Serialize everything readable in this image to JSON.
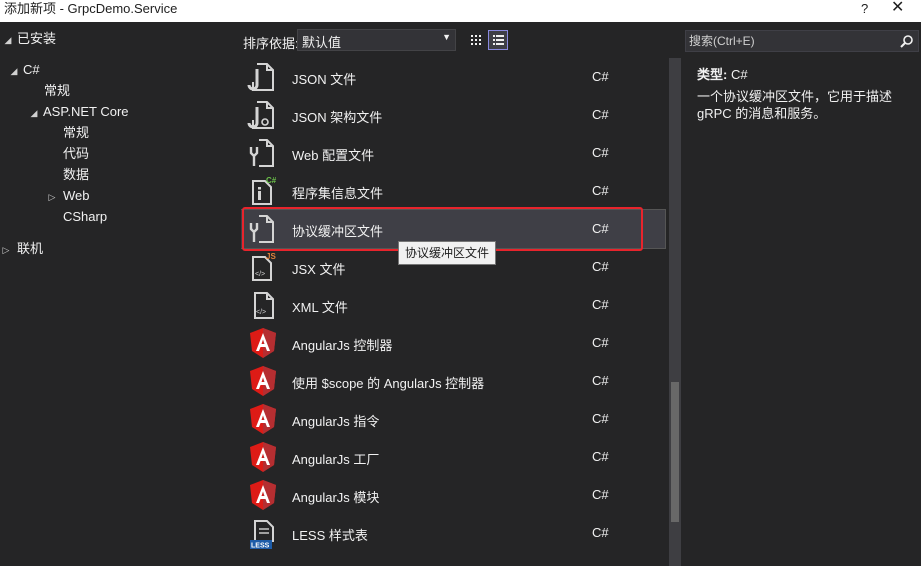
{
  "window": {
    "title": "添加新项 - GrpcDemo.Service",
    "help_glyph": "?",
    "close_glyph": "✕"
  },
  "tree": {
    "installed": "已安装",
    "csharp": "C#",
    "general": "常规",
    "aspnet": "ASP.NET Core",
    "aspnet_general": "常规",
    "code": "代码",
    "data": "数据",
    "web": "Web",
    "csharp_item": "CSharp",
    "online": "联机"
  },
  "toolbar": {
    "sort_label": "排序依据:",
    "sort_value": "默认值"
  },
  "templates": [
    {
      "name": "JSON 文件",
      "lang": "C#",
      "icon": "json-file-icon"
    },
    {
      "name": "JSON 架构文件",
      "lang": "C#",
      "icon": "json-schema-file-icon"
    },
    {
      "name": "Web 配置文件",
      "lang": "C#",
      "icon": "web-config-file-icon"
    },
    {
      "name": "程序集信息文件",
      "lang": "C#",
      "icon": "assembly-info-file-icon"
    },
    {
      "name": "协议缓冲区文件",
      "lang": "C#",
      "icon": "protobuf-file-icon"
    },
    {
      "name": "JSX 文件",
      "lang": "C#",
      "icon": "jsx-file-icon"
    },
    {
      "name": "XML 文件",
      "lang": "C#",
      "icon": "xml-file-icon"
    },
    {
      "name": "AngularJs 控制器",
      "lang": "C#",
      "icon": "angularjs-icon"
    },
    {
      "name": "使用 $scope 的 AngularJs 控制器",
      "lang": "C#",
      "icon": "angularjs-icon"
    },
    {
      "name": "AngularJs 指令",
      "lang": "C#",
      "icon": "angularjs-icon"
    },
    {
      "name": "AngularJs 工厂",
      "lang": "C#",
      "icon": "angularjs-icon"
    },
    {
      "name": "AngularJs 模块",
      "lang": "C#",
      "icon": "angularjs-icon"
    },
    {
      "name": "LESS 样式表",
      "lang": "C#",
      "icon": "less-file-icon"
    }
  ],
  "selected_index": 4,
  "tooltip": "协议缓冲区文件",
  "icon_badges": {
    "assembly": "C#",
    "jsx": "JS",
    "less": "LESS"
  },
  "search": {
    "placeholder": "搜索(Ctrl+E)"
  },
  "details": {
    "type_label": "类型:",
    "type_value": "C#",
    "description": "一个协议缓冲区文件，它用于描述 gRPC 的消息和服务。"
  },
  "colors": {
    "background": "#252526",
    "highlight_border": "#e8242c",
    "angular_red": "#dd1b16"
  }
}
